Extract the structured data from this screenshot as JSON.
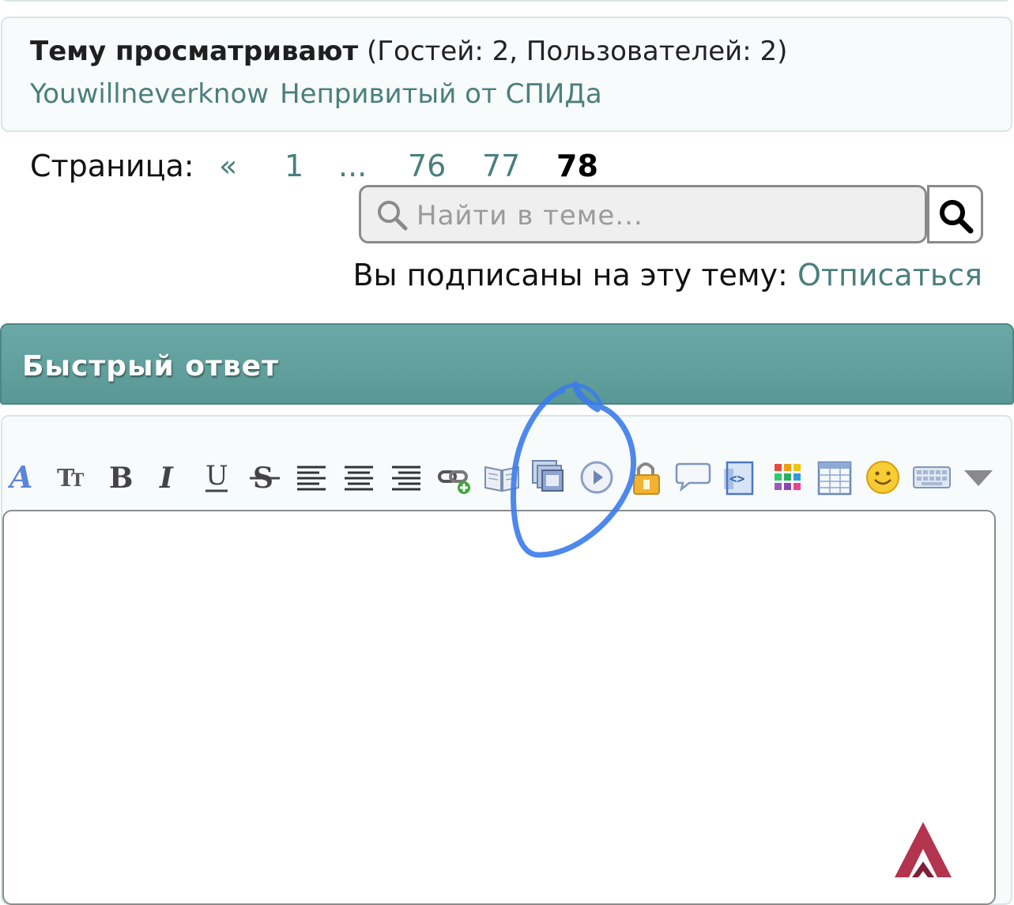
{
  "viewers": {
    "title": "Тему просматривают",
    "counts": "(Гостей: 2, Пользователей: 2)",
    "users": [
      "Youwillneverknow",
      "Непривитый от СПИДа"
    ]
  },
  "pagination": {
    "label": "Страница:",
    "prev": "«",
    "pages": [
      "1",
      "...",
      "76",
      "77"
    ],
    "current": "78"
  },
  "search": {
    "placeholder": "Найти в теме..."
  },
  "subscription": {
    "text": "Вы подписаны на эту тему:",
    "unsubscribe_label": "Отписаться"
  },
  "quick_reply": {
    "title": "Быстрый ответ",
    "toolbar": [
      "font-icon",
      "font-size-icon",
      "bold-icon",
      "italic-icon",
      "underline-icon",
      "strikethrough-icon",
      "align-left-icon",
      "align-center-icon",
      "align-right-icon",
      "link-icon",
      "book-icon",
      "gallery-icon",
      "media-play-icon",
      "lock-icon",
      "speech-bubble-icon",
      "code-icon",
      "color-grid-icon",
      "table-icon",
      "smiley-icon",
      "keyboard-icon",
      "more-dropdown-icon"
    ],
    "text_value": ""
  },
  "colors": {
    "accent": "#4a7f7c",
    "header": "#5f9e9b",
    "annotation": "#3b7bea",
    "logo": "#b2344f"
  }
}
